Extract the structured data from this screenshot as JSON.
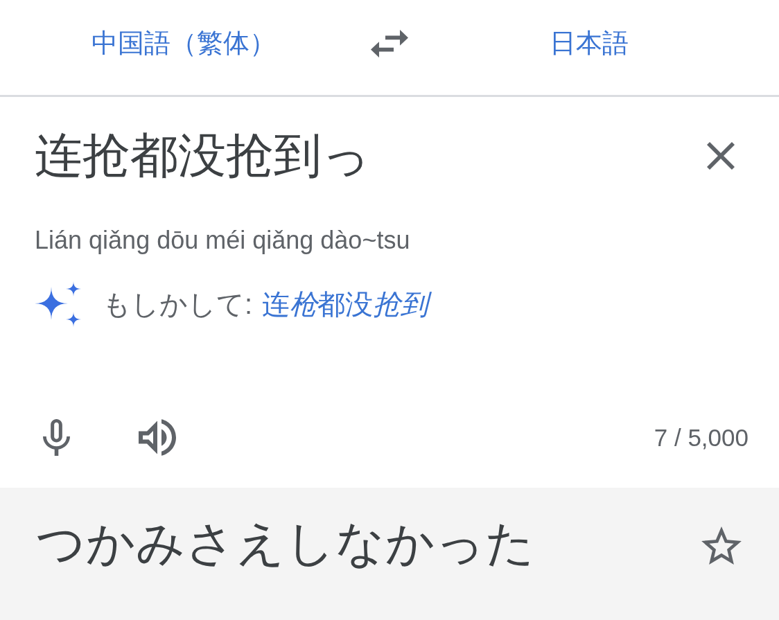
{
  "language_bar": {
    "source_language": "中国語（繁体）",
    "target_language": "日本語"
  },
  "input": {
    "text": "连抢都没抢到っ",
    "romanization": "Lián qiǎng dōu méi qiǎng dào~tsu",
    "suggestion": {
      "label": "もしかして:",
      "parts": [
        {
          "text": "连",
          "italic": false
        },
        {
          "text": "枪",
          "italic": true
        },
        {
          "text": "都没",
          "italic": false
        },
        {
          "text": "抢到",
          "italic": true
        }
      ]
    },
    "char_count": "7 / 5,000"
  },
  "output": {
    "text": "つかみさえしなかった",
    "starred": false
  }
}
